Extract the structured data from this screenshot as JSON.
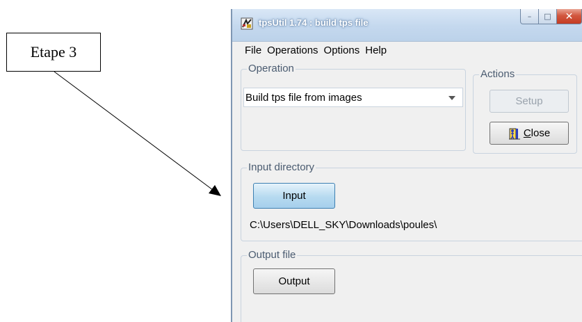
{
  "annotation": {
    "label": "Etape 3"
  },
  "window": {
    "title": "tpsUtil 1.74 : build tps file",
    "controls": {
      "minimize": "–",
      "maximize": "□",
      "close": "✕"
    }
  },
  "menu": [
    "File",
    "Operations",
    "Options",
    "Help"
  ],
  "operation": {
    "label": "Operation",
    "selected": "Build tps file from images"
  },
  "actions": {
    "label": "Actions",
    "setup": "Setup",
    "close_underline": "C",
    "close_rest": "lose"
  },
  "input_directory": {
    "label": "Input directory",
    "button": "Input",
    "path": "C:\\Users\\DELL_SKY\\Downloads\\poules\\"
  },
  "output_file": {
    "label": "Output file",
    "button": "Output"
  },
  "colors": {
    "selected_button": "#b6daf0",
    "close_button": "#c43b22",
    "title_bar": "#c4d8ee"
  }
}
